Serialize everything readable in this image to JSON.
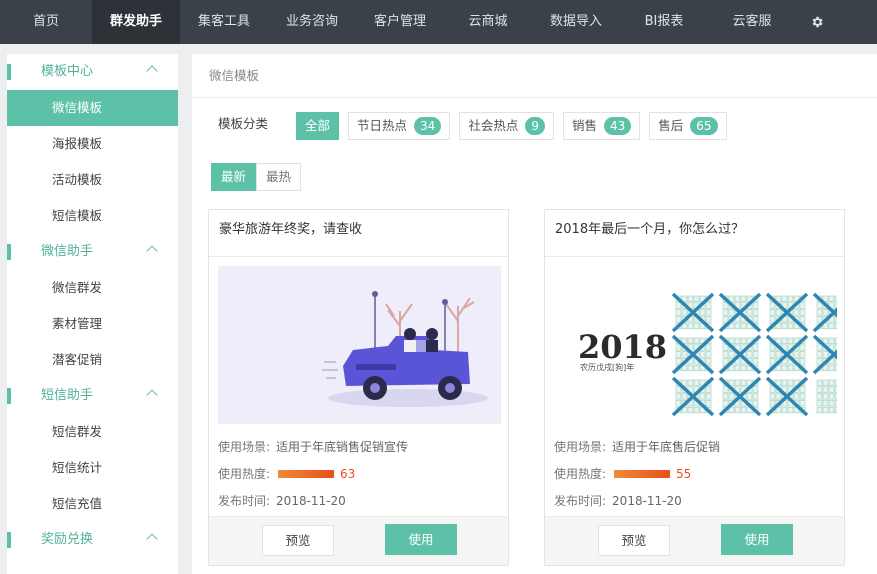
{
  "nav": {
    "items": [
      "首页",
      "群发助手",
      "集客工具",
      "业务咨询",
      "客户管理",
      "云商城",
      "数据导入",
      "BI报表",
      "云客服"
    ],
    "active_index": 1,
    "settings_icon": "gear-icon"
  },
  "sidebar": {
    "groups": [
      {
        "label": "模板中心",
        "items": [
          "微信模板",
          "海报模板",
          "活动模板",
          "短信模板"
        ]
      },
      {
        "label": "微信助手",
        "items": [
          "微信群发",
          "素材管理",
          "潜客促销"
        ]
      },
      {
        "label": "短信助手",
        "items": [
          "短信群发",
          "短信统计",
          "短信充值"
        ]
      },
      {
        "label": "奖励兑换",
        "items": []
      }
    ],
    "active_item": "微信模板"
  },
  "main": {
    "breadcrumb": "微信模板",
    "filter_label": "模板分类",
    "categories": [
      {
        "label": "全部",
        "count": null
      },
      {
        "label": "节日热点",
        "count": "34"
      },
      {
        "label": "社会热点",
        "count": "9"
      },
      {
        "label": "销售",
        "count": "43"
      },
      {
        "label": "售后",
        "count": "65"
      }
    ],
    "sort": [
      "最新",
      "最热"
    ],
    "cards": [
      {
        "title": "豪华旅游年终奖，请查收",
        "scene_label": "使用场景:",
        "scene": "适用于年底销售促销宣传",
        "heat_label": "使用热度:",
        "heat": "63",
        "date_label": "发布时间:",
        "date": "2018-11-20",
        "preview": "预览",
        "use": "使用"
      },
      {
        "title": "2018年最后一个月，你怎么过？",
        "scene_label": "使用场景:",
        "scene": "适用于年底售后促销",
        "heat_label": "使用热度:",
        "heat": "55",
        "date_label": "发布时间:",
        "date": "2018-11-20",
        "preview": "预览",
        "use": "使用",
        "image_text": "2018",
        "image_subtext": "农历戊戌[狗]年"
      }
    ]
  },
  "colors": {
    "accent": "#5cc1a7",
    "nav_bg": "#3a4148",
    "heat": "#e8501a"
  }
}
